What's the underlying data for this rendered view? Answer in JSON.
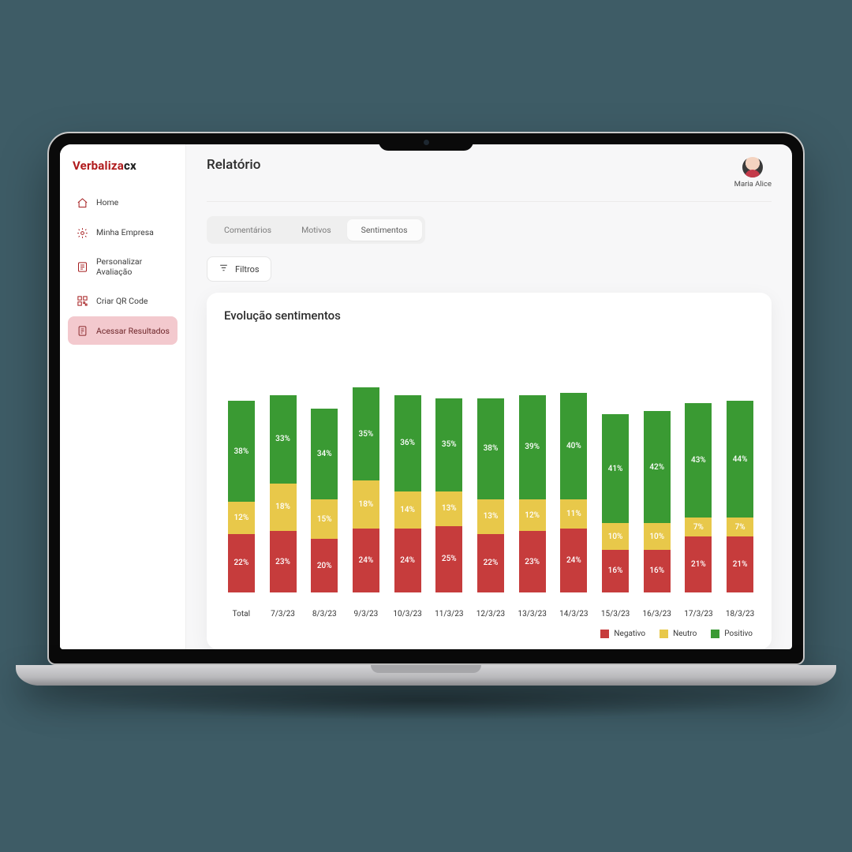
{
  "brand": {
    "name": "Verbaliza",
    "suffix": "cx"
  },
  "sidebar": {
    "items": [
      {
        "label": "Home"
      },
      {
        "label": "Minha Empresa"
      },
      {
        "label": "Personalizar Avaliação"
      },
      {
        "label": "Criar QR Code"
      },
      {
        "label": "Acessar Resultados"
      }
    ]
  },
  "header": {
    "title": "Relatório",
    "user_name": "Maria Alice"
  },
  "tabs": {
    "items": [
      "Comentários",
      "Motivos",
      "Sentimentos"
    ],
    "active_index": 2
  },
  "filters": {
    "label": "Filtros"
  },
  "card": {
    "title": "Evolução sentimentos"
  },
  "legend": {
    "neg": "Negativo",
    "neu": "Neutro",
    "pos": "Positivo"
  },
  "colors": {
    "neg": "#c63c3c",
    "neu": "#e8c84a",
    "pos": "#3a9a33",
    "accent": "#b01a1c"
  },
  "chart_data": {
    "type": "bar",
    "stacked": true,
    "title": "Evolução sentimentos",
    "xlabel": "",
    "ylabel": "",
    "categories": [
      "Total",
      "7/3/23",
      "8/3/23",
      "9/3/23",
      "10/3/23",
      "11/3/23",
      "12/3/23",
      "13/3/23",
      "14/3/23",
      "15/3/23",
      "16/3/23",
      "17/3/23",
      "18/3/23"
    ],
    "series": [
      {
        "name": "Negativo",
        "values": [
          22,
          23,
          20,
          24,
          24,
          25,
          22,
          23,
          24,
          16,
          16,
          21,
          21
        ]
      },
      {
        "name": "Neutro",
        "values": [
          12,
          18,
          15,
          18,
          14,
          13,
          13,
          12,
          11,
          10,
          10,
          7,
          7
        ]
      },
      {
        "name": "Positivo",
        "values": [
          38,
          33,
          34,
          35,
          36,
          35,
          38,
          39,
          40,
          41,
          42,
          43,
          44
        ]
      }
    ],
    "ylim": [
      0,
      80
    ],
    "legend_position": "bottom-right"
  }
}
